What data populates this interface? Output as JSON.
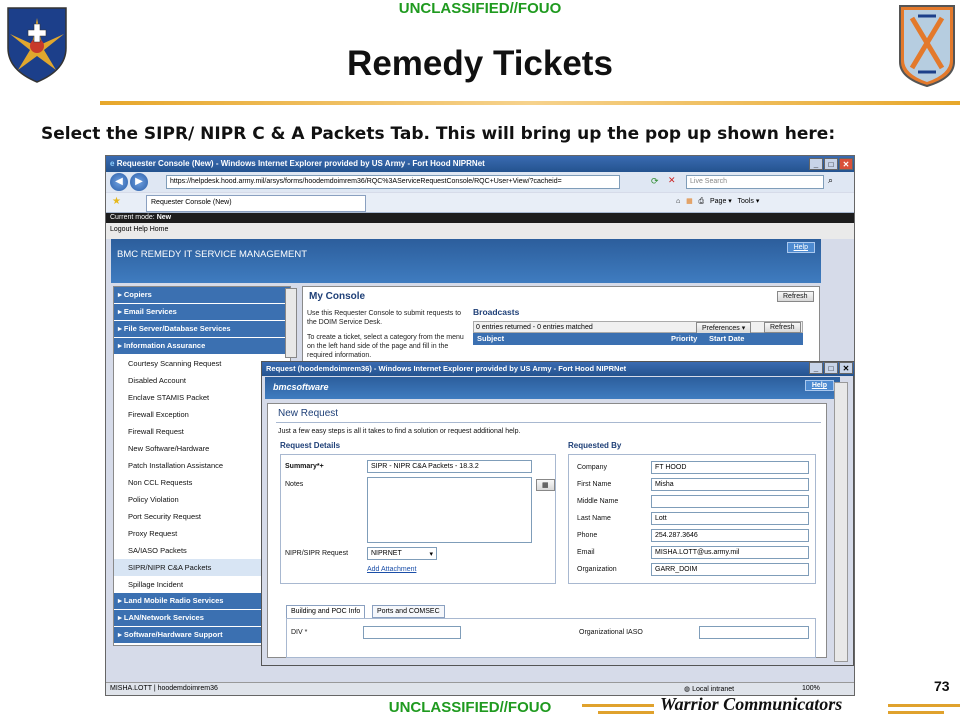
{
  "slide": {
    "classification": "UNCLASSIFIED//FOUO",
    "title": "Remedy Tickets",
    "instruction": "Select the SIPR/ NIPR C & A Packets Tab. This will bring up the pop up shown here:",
    "page_number": "73",
    "motto": "Warrior Communicators"
  },
  "browser": {
    "window_title": "Requester Console (New) - Windows Internet Explorer provided by US Army - Fort Hood NIPRNet",
    "address": "https://helpdesk.hood.army.mil/arsys/forms/hoodemdoimrem36/RQC%3AServiceRequestConsole/RQC+User+View/?cacheid=",
    "search_placeholder": "Live Search",
    "tab_label": "Requester Console (New)",
    "page_menu": "Page",
    "tools_menu": "Tools",
    "status_user": "MISHA.LOTT | hoodemdoimrem36",
    "status_zone": "Local intranet",
    "zoom": "100%"
  },
  "remedy": {
    "mode_label": "Current mode:",
    "mode_value": "New",
    "links": "Logout Help Home",
    "header": "BMC REMEDY IT SERVICE MANAGEMENT",
    "help": "Help"
  },
  "nav": {
    "items": [
      {
        "label": "Copiers",
        "type": "header"
      },
      {
        "label": "Email Services",
        "type": "header"
      },
      {
        "label": "File Server/Database Services",
        "type": "header"
      },
      {
        "label": "Information Assurance",
        "type": "header"
      },
      {
        "label": "Courtesy Scanning Request",
        "type": "item"
      },
      {
        "label": "Disabled Account",
        "type": "item"
      },
      {
        "label": "Enclave STAMIS Packet",
        "type": "item"
      },
      {
        "label": "Firewall Exception",
        "type": "item"
      },
      {
        "label": "Firewall Request",
        "type": "item"
      },
      {
        "label": "New Software/Hardware",
        "type": "item"
      },
      {
        "label": "Patch Installation Assistance",
        "type": "item"
      },
      {
        "label": "Non CCL Requests",
        "type": "item"
      },
      {
        "label": "Policy Violation",
        "type": "item"
      },
      {
        "label": "Port Security Request",
        "type": "item"
      },
      {
        "label": "Proxy Request",
        "type": "item"
      },
      {
        "label": "SA/IASO Packets",
        "type": "item"
      },
      {
        "label": "SIPR/NIPR C&A Packets",
        "type": "item"
      },
      {
        "label": "Spillage Incident",
        "type": "item"
      },
      {
        "label": "Land Mobile Radio Services",
        "type": "header"
      },
      {
        "label": "LAN/Network Services",
        "type": "header"
      },
      {
        "label": "Software/Hardware Support",
        "type": "header"
      }
    ]
  },
  "console": {
    "title": "My Console",
    "refresh": "Refresh",
    "intro": "Use this Requester Console to submit requests to the DOIM Service Desk.",
    "intro2": "To create a ticket, select a category from the menu on the left hand side of the page and fill in the required information.",
    "broadcasts": "Broadcasts",
    "entries": "0 entries returned - 0 entries matched",
    "preferences": "Preferences",
    "columns": [
      "Subject",
      "Priority",
      "Start Date"
    ]
  },
  "popup": {
    "window_title": "Request (hoodemdoimrem36) - Windows Internet Explorer provided by US Army - Fort Hood NIPRNet",
    "brand": "bmcsoftware",
    "help": "Help",
    "heading": "New Request",
    "steps": "Just a few easy steps is all it takes to find a solution or request additional help.",
    "request_details": "Request Details",
    "summary_label": "Summary*+",
    "summary_value": "SIPR - NIPR C&A Packets - 18.3.2",
    "notes_label": "Notes",
    "network_label": "NIPR/SIPR Request",
    "network_value": "NIPRNET",
    "add_attachment": "Add Attachment",
    "requested_by": "Requested By",
    "fields": [
      {
        "label": "Company",
        "value": "FT HOOD"
      },
      {
        "label": "First Name",
        "value": "Misha"
      },
      {
        "label": "Middle Name",
        "value": ""
      },
      {
        "label": "Last Name",
        "value": "Lott"
      },
      {
        "label": "Phone",
        "value": "254.287.3646"
      },
      {
        "label": "Email",
        "value": "MISHA.LOTT@us.army.mil"
      },
      {
        "label": "Organization",
        "value": "GARR_DOIM"
      }
    ],
    "tabs": [
      "Building and POC Info",
      "Ports and COMSEC"
    ],
    "div_label": "DIV *",
    "iaso_label": "Organizational IASO"
  }
}
